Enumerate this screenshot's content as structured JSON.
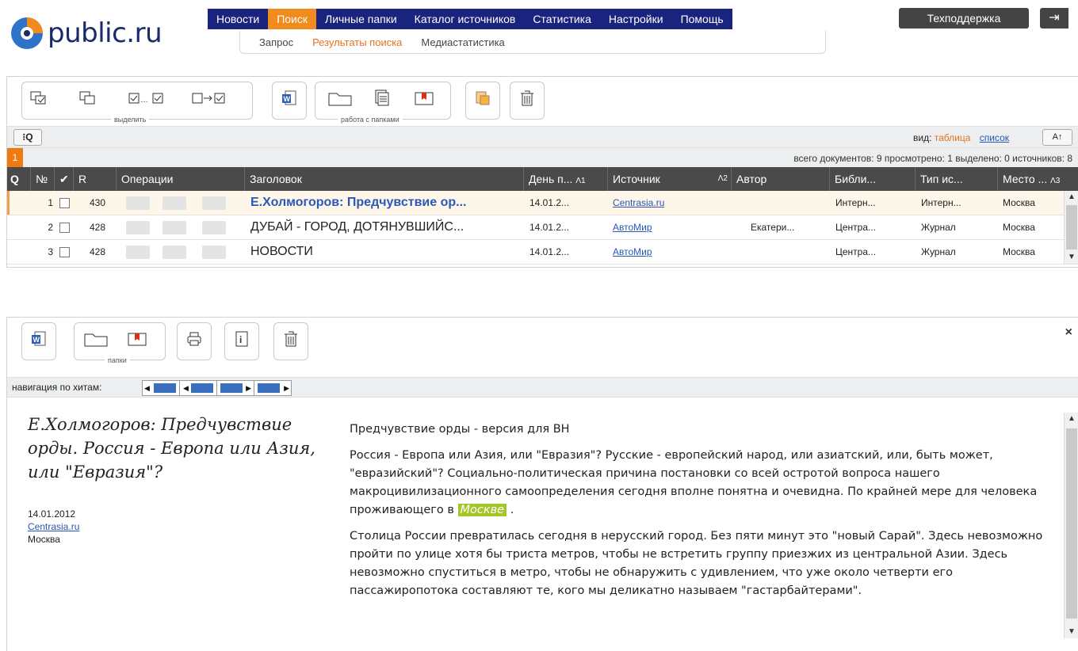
{
  "logo": {
    "text": "public.ru"
  },
  "main_nav": [
    {
      "label": "Новости",
      "active": false
    },
    {
      "label": "Поиск",
      "active": true
    },
    {
      "label": "Личные папки",
      "active": false
    },
    {
      "label": "Каталог источников",
      "active": false
    },
    {
      "label": "Статистика",
      "active": false
    },
    {
      "label": "Настройки",
      "active": false
    },
    {
      "label": "Помощь",
      "active": false
    }
  ],
  "sub_nav": [
    {
      "label": "Запрос",
      "active": false
    },
    {
      "label": "Результаты поиска",
      "active": true
    },
    {
      "label": "Медиастатистика",
      "active": false
    }
  ],
  "support_label": "Техподдержка",
  "toolbar": {
    "select_group_label": "выделить",
    "folders_group_label": "работа с папками"
  },
  "filter_bar": {
    "search_icon_label": "⁝Q",
    "view_label": "вид:",
    "view_active": "таблица",
    "view_other": "список"
  },
  "page_bar": {
    "current_page": "1",
    "stats": "всего документов: 9   просмотрено: 1   выделено: 0   источников: 8"
  },
  "table": {
    "columns": {
      "search": "Q",
      "num": "№",
      "check": "✔",
      "rank": "R",
      "ops": "Операции",
      "title": "Заголовок",
      "day": "День п...",
      "day_sort": "Λ1",
      "source": "Источник",
      "source_sort": "Λ2",
      "author": "Автор",
      "library": "Библи...",
      "type": "Тип ис...",
      "place": "Место ...",
      "place_sort": "Λ3"
    },
    "rows": [
      {
        "num": "1",
        "rank": "430",
        "title": "Е.Холмогоров: Предчувствие ор...",
        "date": "14.01.2...",
        "source": "Centrasia.ru",
        "author": "",
        "library": "Интерн...",
        "type": "Интерн...",
        "place": "Москва"
      },
      {
        "num": "2",
        "rank": "428",
        "title": "ДУБАЙ - ГОРОД, ДОТЯНУВШИЙС...",
        "date": "14.01.2...",
        "source": "АвтоМир",
        "author": "Екатери...",
        "library": "Центра...",
        "type": "Журнал",
        "place": "Москва"
      },
      {
        "num": "3",
        "rank": "428",
        "title": "НОВОСТИ",
        "date": "14.01.2...",
        "source": "АвтоМир",
        "author": "",
        "library": "Центра...",
        "type": "Журнал",
        "place": "Москва"
      }
    ]
  },
  "doc_panel": {
    "folders_group_label": "папки",
    "nav_label": "навигация по хитам:",
    "title": "Е.Холмогоров: Предчувствие орды. Россия - Европа или Азия, или \"Евразия\"?",
    "date": "14.01.2012",
    "source": "Centrasia.ru",
    "place": "Москва",
    "subtitle": "Предчувствие орды - версия для ВН",
    "para1_before": "Россия - Европа или Азия, или \"Евразия\"? Русские - европейский народ, или азиатский, или, быть может, \"евразийский\"? Социально-политическая причина постановки со всей остротой вопроса нашего макроцивилизационного самоопределения сегодня вполне понятна и очевидна. По крайней мере для человека проживающего в",
    "para1_highlight": "Москве",
    "para1_after": " .",
    "para2": "Столица России превратилась сегодня в нерусский город. Без пяти минут это \"новый Сарай\". Здесь невозможно пройти по улице хотя бы триста метров, чтобы не встретить группу приезжих из центральной Азии. Здесь невозможно спуститься в метро, чтобы не обнаружить с удивлением, что уже около четверти его пассажиропотока составляют те, кого мы деликатно называем \"гастарбайтерами\"."
  }
}
